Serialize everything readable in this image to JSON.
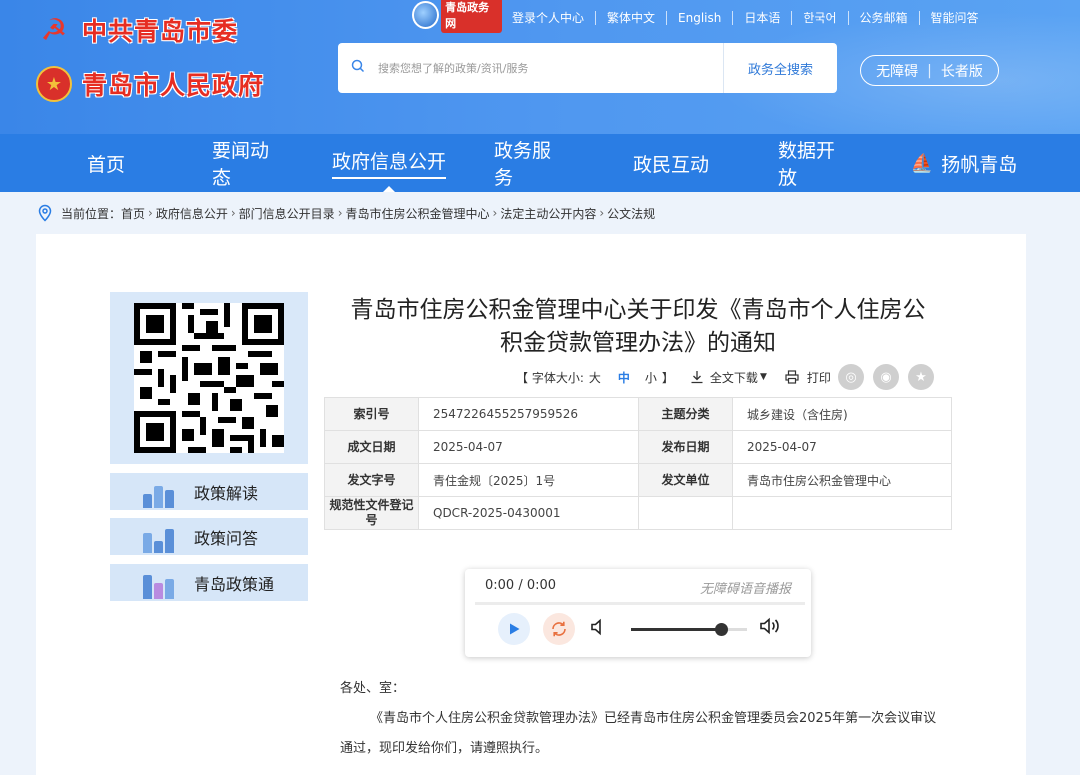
{
  "header": {
    "party_name": "中共青岛市委",
    "gov_name": "青岛市人民政府",
    "portal_badge": "青岛政务网",
    "top_links": [
      "登录个人中心",
      "繁体中文",
      "English",
      "日本语",
      "한국어",
      "公务邮箱",
      "智能问答"
    ],
    "search": {
      "placeholder": "搜索您想了解的政策/资讯/服务",
      "button": "政务全搜索"
    },
    "access": {
      "barrier_free": "无障碍",
      "elder": "长者版"
    }
  },
  "nav": {
    "items": [
      "首页",
      "要闻动态",
      "政府信息公开",
      "政务服务",
      "政民互动",
      "数据开放",
      "扬帆青岛"
    ],
    "active_index": 2
  },
  "breadcrumb": {
    "prefix": "当前位置：",
    "items": [
      "首页",
      "政府信息公开",
      "部门信息公开目录",
      "青岛市住房公积金管理中心",
      "法定主动公开内容",
      "公文法规"
    ]
  },
  "sidebar": {
    "items": [
      "政策解读",
      "政策问答",
      "青岛政策通"
    ]
  },
  "document": {
    "title_line1": "青岛市住房公积金管理中心关于印发《青岛市个人住房公",
    "title_line2": "积金贷款管理办法》的通知",
    "tools": {
      "font_size_label": "【 字体大小:",
      "size_large": "大",
      "size_medium": "中",
      "size_small": "小",
      "bracket_close": "】",
      "download": "全文下载",
      "print": "打印"
    },
    "meta": {
      "index_no_label": "索引号",
      "index_no": "2547226455257959526",
      "topic_label": "主题分类",
      "topic": "城乡建设（含住房)",
      "written_date_label": "成文日期",
      "written_date": "2025-04-07",
      "publish_date_label": "发布日期",
      "publish_date": "2025-04-07",
      "doc_no_label": "发文字号",
      "doc_no": "青住金规〔2025〕1号",
      "issuer_label": "发文单位",
      "issuer": "青岛市住房公积金管理中心",
      "reg_no_label": "规范性文件登记号",
      "reg_no": "QDCR-2025-0430001"
    },
    "player": {
      "time": "0:00 / 0:00",
      "tag": "无障碍语音播报",
      "volume": 0.78
    },
    "body": {
      "greeting": "各处、室：",
      "para1": "《青岛市个人住房公积金贷款管理办法》已经青岛市住房公积金管理委员会2025年第一次会议审议",
      "para1_cont": "通过，现印发给你们，请遵照执行。"
    }
  }
}
